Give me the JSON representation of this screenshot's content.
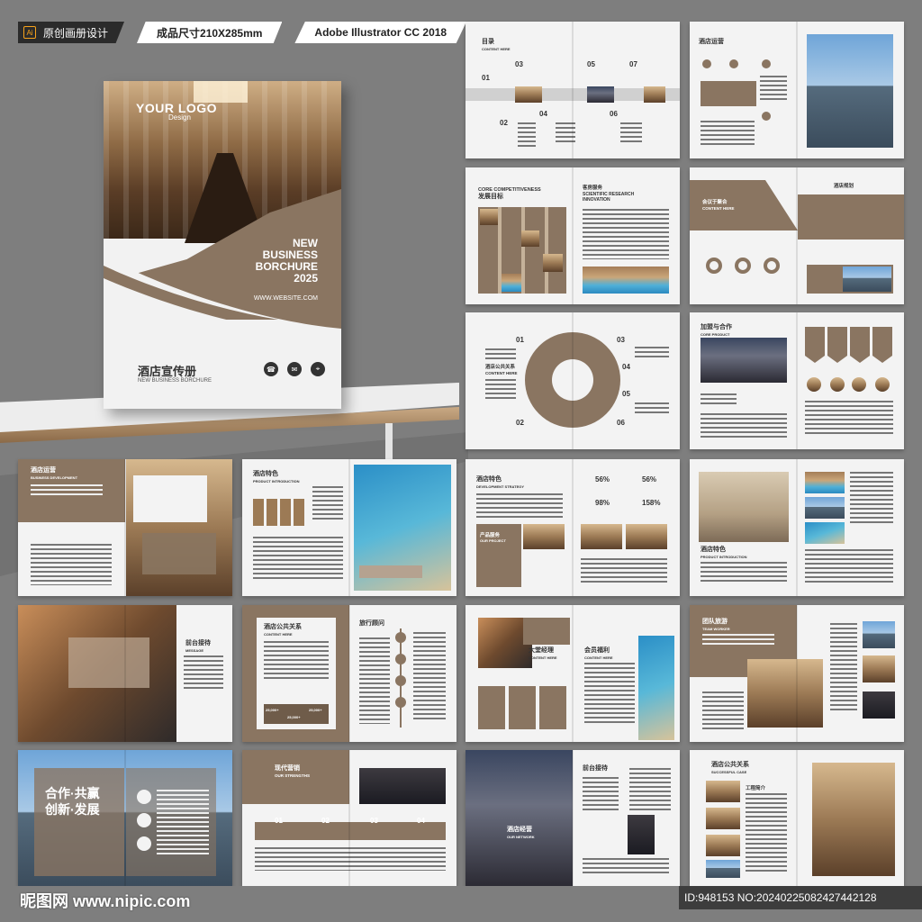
{
  "banner": {
    "ai_badge": "Ai",
    "label1": "原创画册设计",
    "label2": "成品尺寸210X285mm",
    "label3": "Adobe Illustrator CC 2018"
  },
  "cover": {
    "logo": "YOUR LOGO",
    "logo_sub": "Design",
    "title_lines": [
      "NEW",
      "BUSINESS",
      "BORCHURE",
      "2025"
    ],
    "website": "WWW.WEBSITE.COM",
    "cn_title": "酒店宣传册",
    "en_title": "NEW BUSINESS BORCHURE"
  },
  "spreads": {
    "s1": {
      "title": "目录",
      "sub": "CONTENT HERE",
      "nums": [
        "01",
        "02",
        "03",
        "04",
        "05",
        "06",
        "07"
      ]
    },
    "s2": {
      "title": "酒店运营"
    },
    "s3": {
      "title_en1": "CORE COMPETITIVENESS",
      "title_cn": "发展目标",
      "right_cn": "客房服务",
      "right_en1": "SCIENTIFIC RESEARCH",
      "right_en2": "INNOVATION"
    },
    "s4": {
      "left": "会议于聚合",
      "left_en": "CONTENT HERE",
      "right": "酒店规划"
    },
    "s5": {
      "center_cn": "酒店公共关系",
      "center_en": "CONTENT HERE",
      "nums": [
        "01",
        "02",
        "03",
        "04",
        "05",
        "06"
      ]
    },
    "s6": {
      "title": "加盟与合作",
      "sub": "CORE PRODUCT"
    },
    "s7": {
      "title": "酒店运营",
      "sub": "BUSINESS DEVELOPMENT"
    },
    "s8": {
      "title": "酒店特色",
      "sub": "PRODUCT INTRODUCTION"
    },
    "s9": {
      "title": "酒店特色",
      "sub": "DEVELOPMENT STRATEGY",
      "stats": [
        "56%",
        "56%",
        "98%",
        "158%"
      ],
      "box": "产品服务",
      "box_en": "OUR PROJECT"
    },
    "s10": {
      "title": "酒店特色",
      "sub": "PRODUCT INTRODUCTION"
    },
    "s11": {
      "title": "前台接待",
      "sub": "MESSAGE"
    },
    "s12": {
      "title": "酒店公共关系",
      "sub": "CONTENT HERE",
      "right": "旅行顾问",
      "stats": [
        "25,000+",
        "25,000+",
        "25,000+"
      ]
    },
    "s13": {
      "title": "大堂经理",
      "sub": "CONTENT HERE",
      "right": "会员福利",
      "right_sub": "CONTENT HERE"
    },
    "s14": {
      "title": "团队旅游",
      "sub": "TEAM WORKER"
    },
    "s15": {
      "line1": "合作·共赢",
      "line2": "创新·发展"
    },
    "s16": {
      "title": "现代营销",
      "sub": "OUR STRENGTHS",
      "nums": [
        "01",
        "02",
        "03",
        "04"
      ]
    },
    "s17": {
      "title": "酒店经营",
      "sub": "OUR NETWORK",
      "right": "前台接待"
    },
    "s18": {
      "title": "酒店公共关系",
      "sub": "SUCCESSFUL CASE",
      "mid": "工程简介"
    }
  },
  "watermark": {
    "left": "昵图网 www.nipic.com",
    "right": "ID:948153 NO:20240225082427442128"
  },
  "colors": {
    "brown": "#8a7561",
    "dark_brown": "#6f5c4a",
    "background": "#7e7e7e"
  }
}
